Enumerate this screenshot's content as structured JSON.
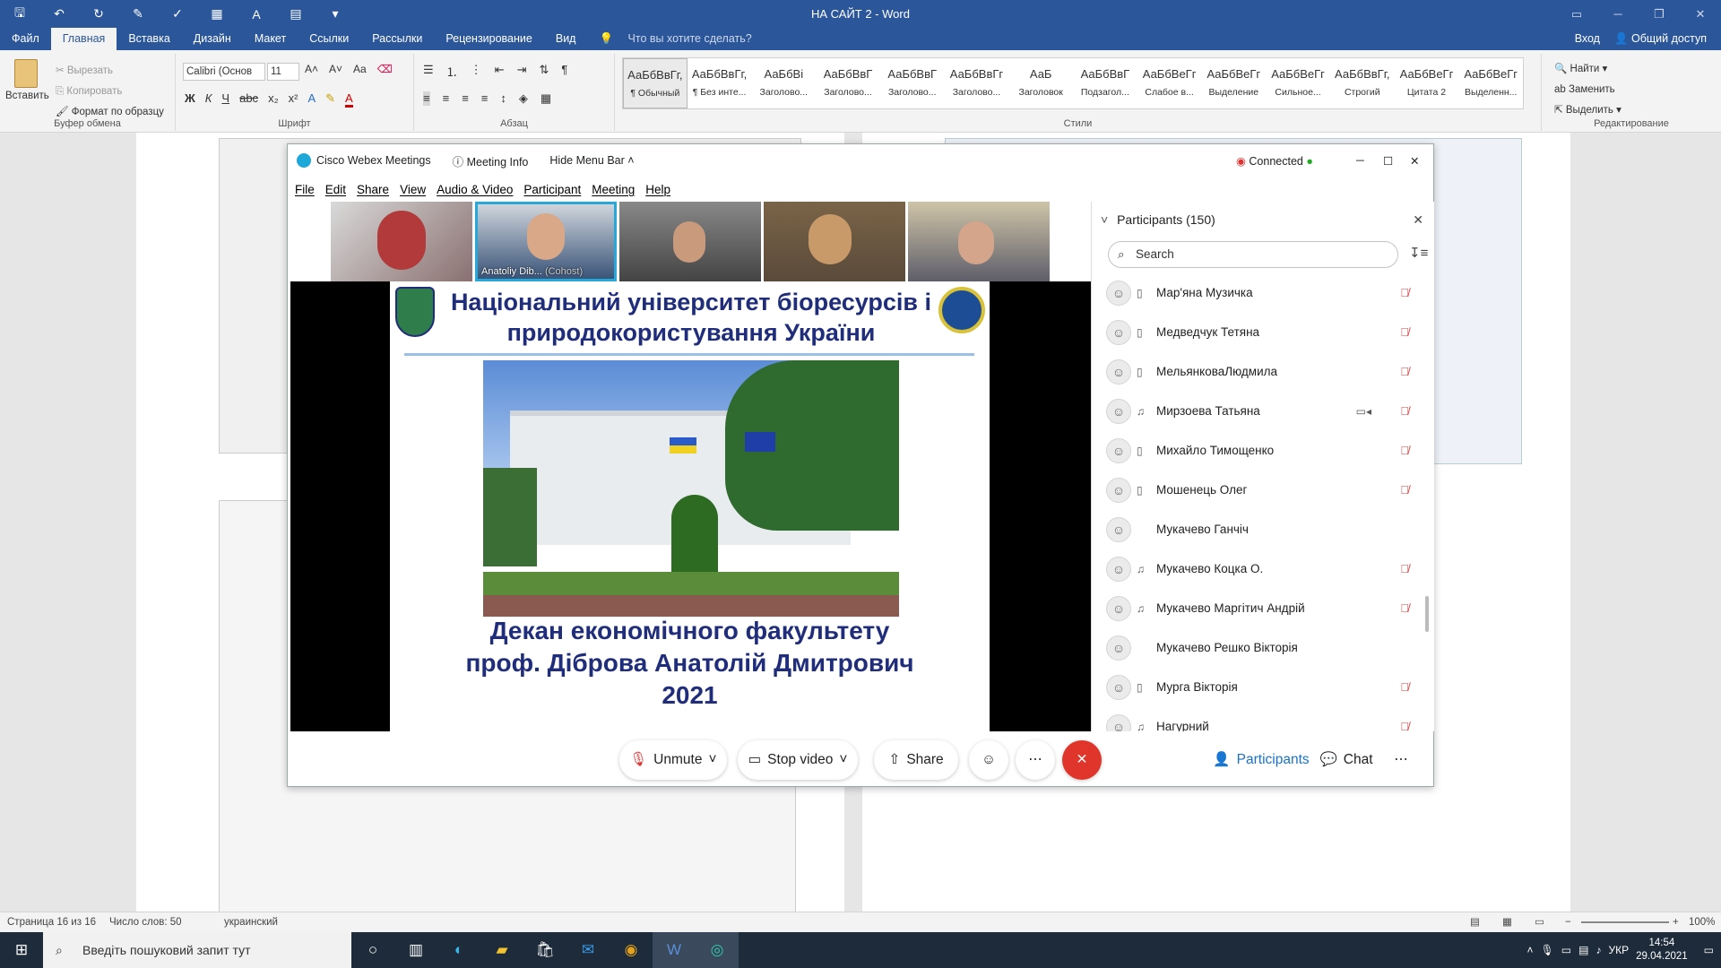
{
  "word": {
    "title": "НА САЙТ 2 - Word",
    "tabs": [
      "Файл",
      "Главная",
      "Вставка",
      "Дизайн",
      "Макет",
      "Ссылки",
      "Рассылки",
      "Рецензирование",
      "Вид"
    ],
    "tell_me": "Что вы хотите сделать?",
    "login": "Вход",
    "share": "Общий доступ",
    "clipboard": {
      "paste": "Вставить",
      "cut": "Вырезать",
      "copy": "Копировать",
      "format": "Формат по образцу",
      "label": "Буфер обмена"
    },
    "font": {
      "name": "Calibri (Основ",
      "size": "11",
      "label": "Шрифт",
      "bold": "Ж",
      "italic": "К",
      "underline": "Ч"
    },
    "paragraph_label": "Абзац",
    "styles_label": "Стили",
    "styles": [
      {
        "sample": "АаБбВвГг,",
        "name": "¶ Обычный"
      },
      {
        "sample": "АаБбВвГг,",
        "name": "¶ Без инте..."
      },
      {
        "sample": "АаБбВі",
        "name": "Заголово..."
      },
      {
        "sample": "АаБбВвГ",
        "name": "Заголово..."
      },
      {
        "sample": "АаБбВвГ",
        "name": "Заголово..."
      },
      {
        "sample": "АаБбВвГг",
        "name": "Заголово..."
      },
      {
        "sample": "АаБ",
        "name": "Заголовок"
      },
      {
        "sample": "АаБбВвГ",
        "name": "Подзагол..."
      },
      {
        "sample": "АаБбВеГг",
        "name": "Слабое в..."
      },
      {
        "sample": "АаБбВеГг",
        "name": "Выделение"
      },
      {
        "sample": "АаБбВеГг",
        "name": "Сильное..."
      },
      {
        "sample": "АаБбВвГг,",
        "name": "Строгий"
      },
      {
        "sample": "АаБбВеГг",
        "name": "Цитата 2"
      },
      {
        "sample": "АаБбВеГг",
        "name": "Выделенн..."
      }
    ],
    "editing": {
      "find": "Найти",
      "replace": "Заменить",
      "select": "Выделить",
      "label": "Редактирование"
    },
    "status": {
      "page": "Страница 16 из 16",
      "words": "Число слов: 50",
      "lang": "украинский",
      "zoom": "100%"
    }
  },
  "webex": {
    "app": "Cisco Webex Meetings",
    "meeting_info": "Meeting Info",
    "hide_menu": "Hide Menu Bar",
    "connected": "Connected",
    "menu": [
      "File",
      "Edit",
      "Share",
      "View",
      "Audio & Video",
      "Participant",
      "Meeting",
      "Help"
    ],
    "thumb_name": "Anatoliy Dib...",
    "thumb_role": "(Cohost)",
    "slide": {
      "title_line1": "Національний університет біоресурсів і",
      "title_line2": "природокористування України",
      "dean_line1": "Декан економічного факультету",
      "dean_line2": "проф. Діброва Анатолій Дмитрович",
      "dean_line3": "2021"
    },
    "controls": {
      "unmute": "Unmute",
      "stop_video": "Stop video",
      "share": "Share",
      "participants": "Participants",
      "chat": "Chat"
    },
    "panel": {
      "title": "Participants (150)",
      "search_placeholder": "Search",
      "participants": [
        {
          "name": "Мар'яна Музичка",
          "device": "▯",
          "muted": true,
          "cam": false
        },
        {
          "name": "Медведчук Тетяна",
          "device": "▯",
          "muted": true,
          "cam": false
        },
        {
          "name": "МельянковаЛюдмила",
          "device": "▯",
          "muted": true,
          "cam": false
        },
        {
          "name": "Мирзоева Татьяна",
          "device": "♫",
          "muted": true,
          "cam": true
        },
        {
          "name": "Михайло Тимощенко",
          "device": "▯",
          "muted": true,
          "cam": false
        },
        {
          "name": "Мошенець Олег",
          "device": "▯",
          "muted": true,
          "cam": false
        },
        {
          "name": "Мукачево Ганчіч",
          "device": "",
          "muted": false,
          "cam": false
        },
        {
          "name": "Мукачево Коцка О.",
          "device": "♫",
          "muted": true,
          "cam": false
        },
        {
          "name": "Мукачево Маргітич Андрій",
          "device": "♫",
          "muted": true,
          "cam": false
        },
        {
          "name": "Мукачево Решко Вікторія",
          "device": "",
          "muted": false,
          "cam": false
        },
        {
          "name": "Мурга Вікторія",
          "device": "▯",
          "muted": true,
          "cam": false
        },
        {
          "name": "Нагурний",
          "device": "♫",
          "muted": true,
          "cam": false
        }
      ]
    }
  },
  "taskbar": {
    "search": "Введіть пошуковий запит тут",
    "lang": "УКР",
    "time": "14:54",
    "date": "29.04.2021"
  }
}
